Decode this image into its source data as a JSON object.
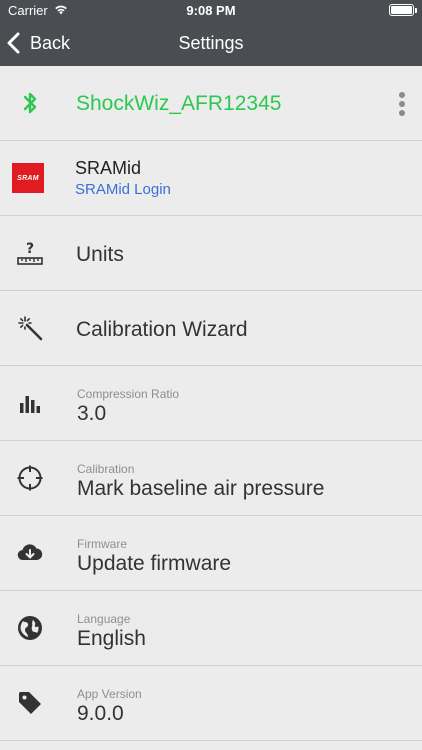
{
  "status_bar": {
    "carrier": "Carrier",
    "time": "9:08 PM"
  },
  "nav": {
    "back_label": "Back",
    "title": "Settings"
  },
  "device": {
    "name": "ShockWiz_AFR12345",
    "accent": "#2cc84f"
  },
  "sram": {
    "logo_text": "SRAM",
    "name": "SRAMid",
    "link": "SRAMid Login",
    "brand": "#e11b22"
  },
  "rows": {
    "units": {
      "label": "Units"
    },
    "calibration_wizard": {
      "label": "Calibration Wizard"
    },
    "compression": {
      "caption": "Compression Ratio",
      "value": "3.0"
    },
    "calibration": {
      "caption": "Calibration",
      "value": "Mark baseline air pressure"
    },
    "firmware": {
      "caption": "Firmware",
      "value": "Update firmware"
    },
    "language": {
      "caption": "Language",
      "value": "English"
    },
    "app_version": {
      "caption": "App Version",
      "value": "9.0.0"
    }
  }
}
